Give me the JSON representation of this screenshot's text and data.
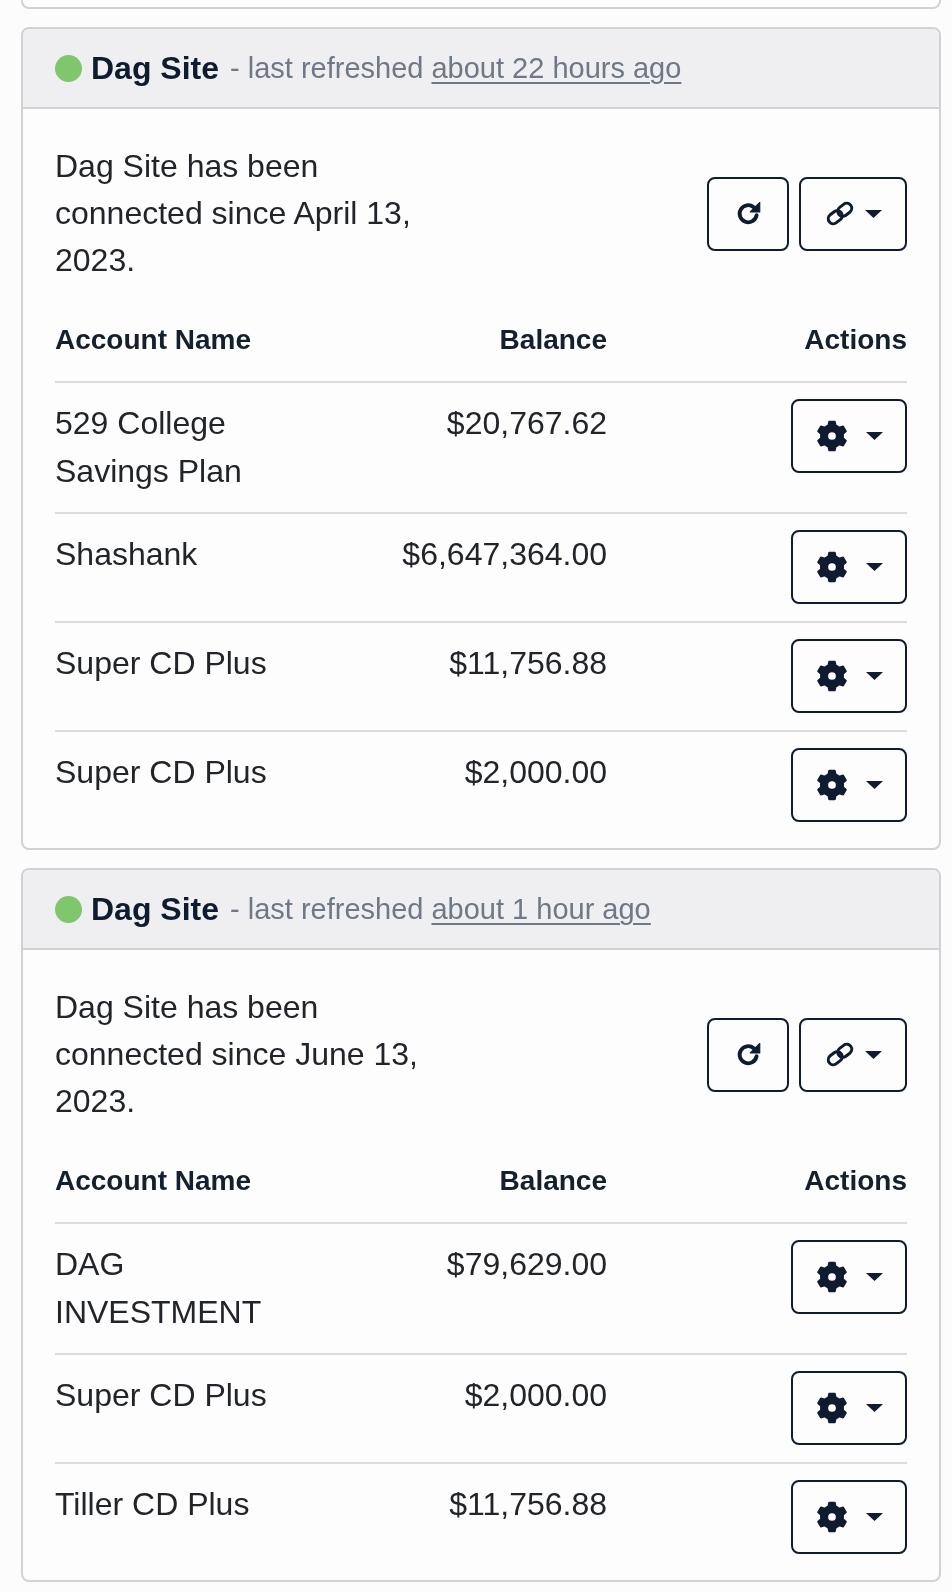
{
  "cards": [
    {
      "color": "#80c66c",
      "title": "Dag Site",
      "refreshed_label": "- last refreshed",
      "refreshed_time": "about 22 hours ago",
      "description": "Dag Site has been connected since April 13, 2023.",
      "columns": [
        "Account Name",
        "Balance",
        "Actions"
      ],
      "accounts": [
        {
          "name": "529 College Savings Plan",
          "balance": "$20,767.62"
        },
        {
          "name": "Shashank",
          "balance": "$6,647,364.00"
        },
        {
          "name": "Super CD Plus",
          "balance": "$11,756.88"
        },
        {
          "name": "Super CD Plus",
          "balance": "$2,000.00"
        }
      ]
    },
    {
      "color": "#80c66c",
      "title": "Dag Site",
      "refreshed_label": "- last refreshed",
      "refreshed_time": "about 1 hour ago",
      "description": "Dag Site has been connected since June 13, 2023.",
      "columns": [
        "Account Name",
        "Balance",
        "Actions"
      ],
      "accounts": [
        {
          "name": "DAG INVESTMENT",
          "balance": "$79,629.00"
        },
        {
          "name": "Super CD Plus",
          "balance": "$2,000.00"
        },
        {
          "name": "Tiller CD Plus",
          "balance": "$11,756.88"
        }
      ]
    }
  ]
}
